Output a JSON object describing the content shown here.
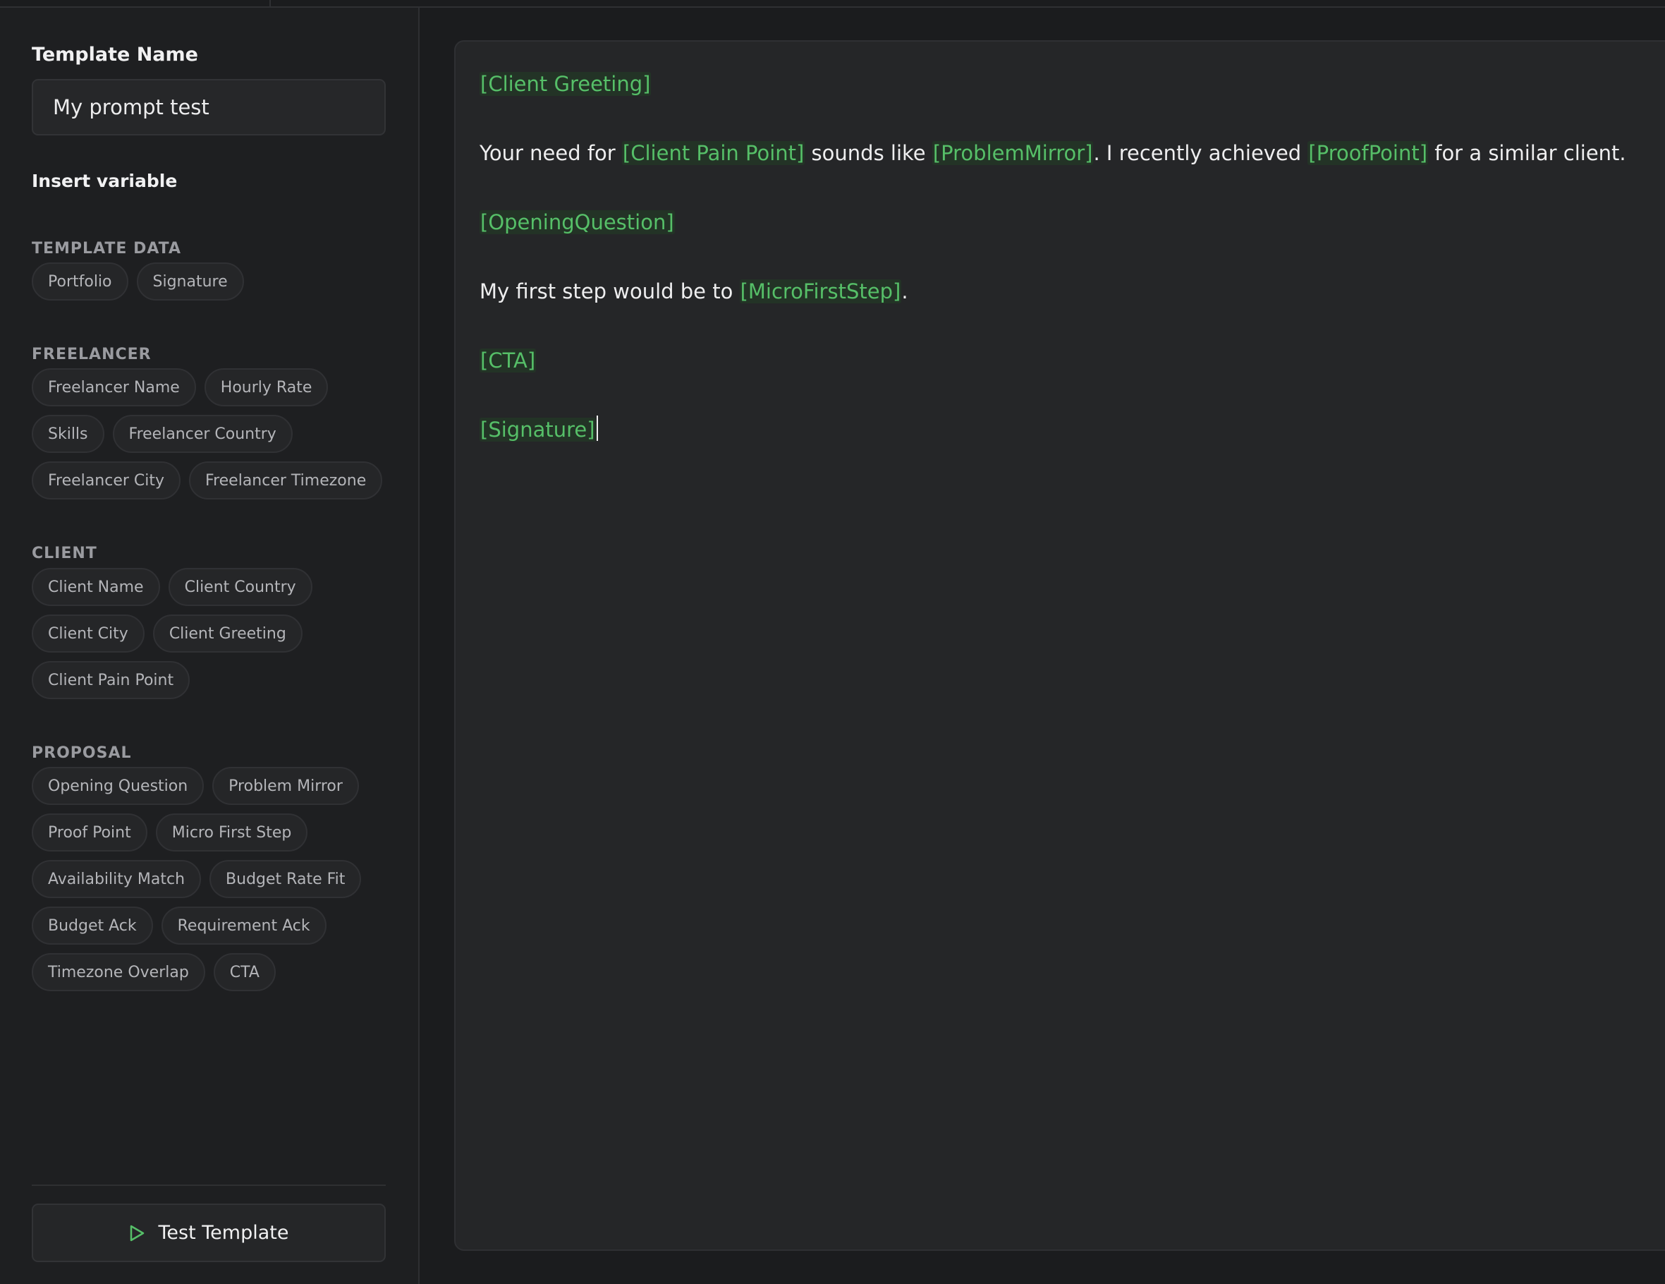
{
  "sidebar": {
    "template_name_label": "Template Name",
    "template_name_value": "My prompt test",
    "insert_variable_label": "Insert variable",
    "groups": [
      {
        "title": "TEMPLATE DATA",
        "rows": [
          [
            "Portfolio",
            "Signature"
          ]
        ]
      },
      {
        "title": "FREELANCER",
        "rows": [
          [
            "Freelancer Name",
            "Hourly Rate"
          ],
          [
            "Skills",
            "Freelancer Country"
          ],
          [
            "Freelancer City",
            "Freelancer Timezone"
          ]
        ]
      },
      {
        "title": "CLIENT",
        "rows": [
          [
            "Client Name",
            "Client Country"
          ],
          [
            "Client City",
            "Client Greeting"
          ],
          [
            "Client Pain Point"
          ]
        ]
      },
      {
        "title": "PROPOSAL",
        "rows": [
          [
            "Opening Question",
            "Problem Mirror"
          ],
          [
            "Proof Point",
            "Micro First Step"
          ],
          [
            "Availability Match",
            "Budget Rate Fit"
          ],
          [
            "Budget Ack",
            "Requirement Ack"
          ],
          [
            "Timezone Overlap",
            "CTA"
          ]
        ]
      }
    ],
    "test_button_label": "Test Template"
  },
  "editor": {
    "lines": [
      [
        {
          "var": "[Client Greeting]"
        }
      ],
      [
        {
          "text": "Your need for "
        },
        {
          "var": "[Client Pain Point]"
        },
        {
          "text": " sounds like "
        },
        {
          "var": "[ProblemMirror]"
        },
        {
          "text": ". I recently achieved "
        },
        {
          "var": "[ProofPoint]"
        },
        {
          "text": " for a similar client."
        }
      ],
      [
        {
          "var": "[OpeningQuestion]"
        }
      ],
      [
        {
          "text": "My first step would be to "
        },
        {
          "var": "[MicroFirstStep]"
        },
        {
          "text": "."
        }
      ],
      [
        {
          "var": "[CTA]"
        }
      ],
      [
        {
          "var": "[Signature]"
        }
      ]
    ]
  },
  "colors": {
    "background": "#1b1c1e",
    "panel": "#252628",
    "variable_text": "#56bf68",
    "variable_bg": "#233326",
    "play_icon": "#56bf68"
  },
  "icons": {
    "test_button_icon": "play-icon"
  }
}
